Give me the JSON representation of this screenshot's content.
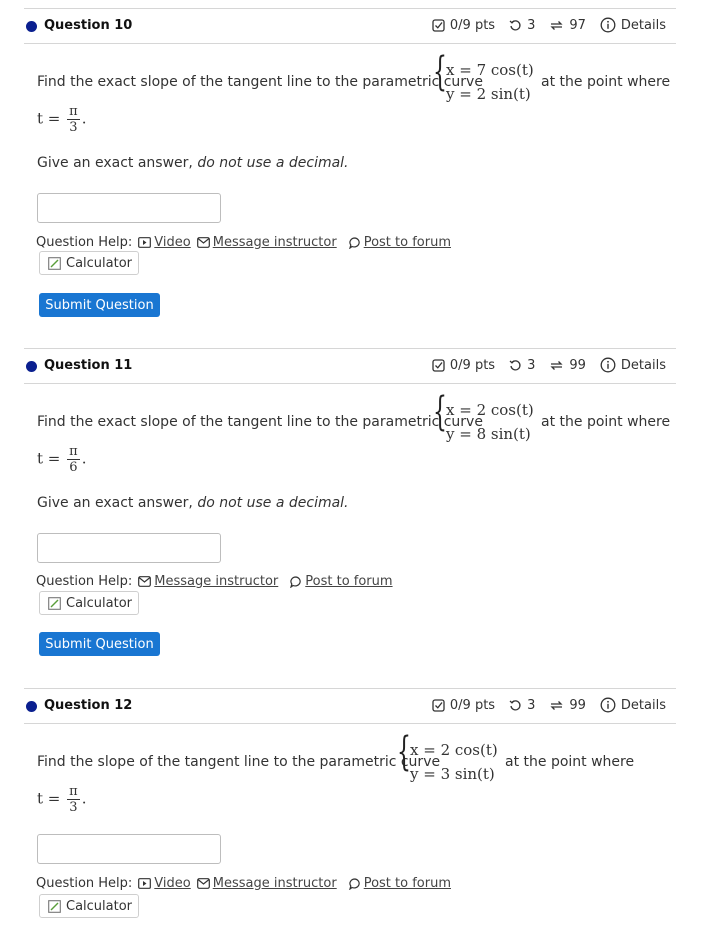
{
  "questions": [
    {
      "title": "Question 10",
      "pts": "0/9 pts",
      "tries": "3",
      "attempts": "97",
      "details": "Details",
      "prompt_pre": "Find the exact slope of the tangent line to the parametric curve",
      "x_eq": "x = 7 cos(t)",
      "y_eq": "y = 2 sin(t)",
      "prompt_post": "at the point where",
      "t_label": "t =",
      "t_num": "π",
      "t_den": "3",
      "instruction_plain": "Give an exact answer, ",
      "instruction_italic": "do not use a decimal.",
      "help_label": "Question Help:",
      "help_video": "Video",
      "help_message": "Message instructor",
      "help_forum": "Post to forum",
      "calculator": "Calculator",
      "submit": "Submit Question"
    },
    {
      "title": "Question 11",
      "pts": "0/9 pts",
      "tries": "3",
      "attempts": "99",
      "details": "Details",
      "prompt_pre": "Find the exact slope of the tangent line to the parametric curve",
      "x_eq": "x = 2 cos(t)",
      "y_eq": "y = 8 sin(t)",
      "prompt_post": "at the point where",
      "t_label": "t =",
      "t_num": "π",
      "t_den": "6",
      "instruction_plain": "Give an exact answer, ",
      "instruction_italic": "do not use a decimal.",
      "help_label": "Question Help:",
      "help_message": "Message instructor",
      "help_forum": "Post to forum",
      "calculator": "Calculator",
      "submit": "Submit Question"
    },
    {
      "title": "Question 12",
      "pts": "0/9 pts",
      "tries": "3",
      "attempts": "99",
      "details": "Details",
      "prompt_pre": "Find the slope of the tangent line to the parametric curve",
      "x_eq": "x = 2 cos(t)",
      "y_eq": "y = 3 sin(t)",
      "prompt_post": "at the point where",
      "t_label": "t =",
      "t_num": "π",
      "t_den": "3",
      "help_label": "Question Help:",
      "help_video": "Video",
      "help_message": "Message instructor",
      "help_forum": "Post to forum",
      "calculator": "Calculator"
    }
  ],
  "colors": {
    "accent": "#1976d2",
    "dot": "#0a1f8f"
  },
  "icons": [
    "checkbox-icon",
    "retry-icon",
    "attempts-icon",
    "info-icon",
    "video-icon",
    "mail-icon",
    "forum-icon",
    "calculator-icon"
  ]
}
